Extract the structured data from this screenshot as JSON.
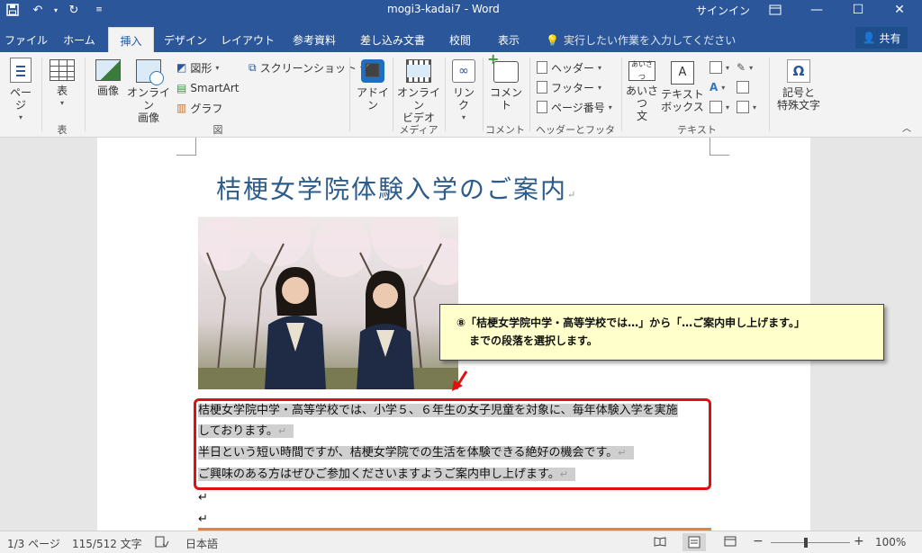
{
  "titlebar": {
    "doc_title": "mogi3-kadai7  -  Word",
    "signin": "サインイン",
    "qa_save_icon": "save-icon",
    "qa_undo_icon": "undo-icon",
    "qa_redo_icon": "redo-icon"
  },
  "tabs": [
    {
      "label": "ファイル"
    },
    {
      "label": "ホーム"
    },
    {
      "label": "挿入"
    },
    {
      "label": "デザイン"
    },
    {
      "label": "レイアウト"
    },
    {
      "label": "参考資料"
    },
    {
      "label": "差し込み文書"
    },
    {
      "label": "校閲"
    },
    {
      "label": "表示"
    }
  ],
  "tellme": "実行したい作業を入力してください",
  "share": "共有",
  "ribbon": {
    "page": "ページ",
    "table": "表",
    "table_group": "表",
    "picture": "画像",
    "online_picture_1": "オンライン",
    "online_picture_2": "画像",
    "shapes": "図形",
    "smartart": "SmartArt",
    "chart": "グラフ",
    "screenshot": "スクリーンショット",
    "illust_group": "図",
    "addin_1": "アドイ",
    "addin_2": "ン",
    "online_video_1": "オンライン",
    "online_video_2": "ビデオ",
    "media_group": "メディア",
    "link": "リンク",
    "comment": "コメント",
    "comment_group": "コメント",
    "header": "ヘッダー",
    "footer": "フッター",
    "page_number": "ページ番号",
    "hf_group": "ヘッダーとフッター",
    "greeting_1": "あいさつ",
    "greeting_2": "文",
    "textbox_1": "テキスト",
    "textbox_2": "ボックス",
    "text_group": "テキスト",
    "symbol_1": "記号と",
    "symbol_2": "特殊文字",
    "greeting_icon_text": "あいさつ",
    "omega": "Ω"
  },
  "document": {
    "heading": "桔梗女学院体験入学のご案内",
    "para1_line1": "桔梗女学院中学・高等学校では、小学５、６年生の女子児童を対象に、毎年体験入学を実施",
    "para1_line2": "しております。",
    "para2": "半日という短い時間ですが、桔梗女学院での生活を体験できる絶好の機会です。",
    "para3": "ご興味のある方はぜひご参加くださいますようご案内申し上げます。",
    "pmark": "↵"
  },
  "callout": {
    "line1": "⑧「桔梗女学院中学・高等学校では…」から「…ご案内申し上げます。」",
    "line2": "までの段落を選択します。"
  },
  "status": {
    "page": "1/3 ページ",
    "words": "115/512 文字",
    "lang": "日本語",
    "zoom": "100%"
  }
}
